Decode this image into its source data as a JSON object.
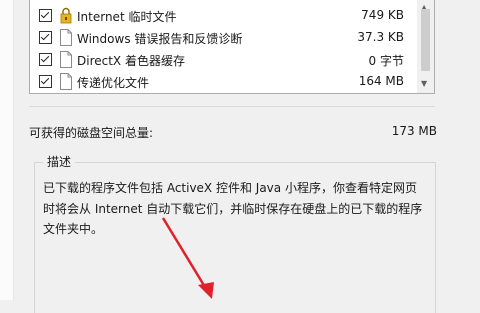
{
  "file_list": {
    "items": [
      {
        "name": "Internet 临时文件",
        "size": "749 KB",
        "icon": "lock-folder-icon"
      },
      {
        "name": "Windows 错误报告和反馈诊断",
        "size": "37.3 KB",
        "icon": "document-icon"
      },
      {
        "name": "DirectX 着色器缓存",
        "size": "0 字节",
        "icon": "document-icon"
      },
      {
        "name": "传递优化文件",
        "size": "164 MB",
        "icon": "document-icon"
      }
    ]
  },
  "disk_space": {
    "label": "可获得的磁盘空间总量:",
    "value": "173 MB"
  },
  "description": {
    "title": "描述",
    "text": "已下载的程序文件包括 ActiveX 控件和 Java 小程序，你查看特定网页时将会从 Internet 自动下载它们，并临时保存在硬盘上的已下载的程序文件夹中。"
  },
  "colors": {
    "selection": "#0078d7",
    "annotation_arrow": "#e0202a"
  }
}
